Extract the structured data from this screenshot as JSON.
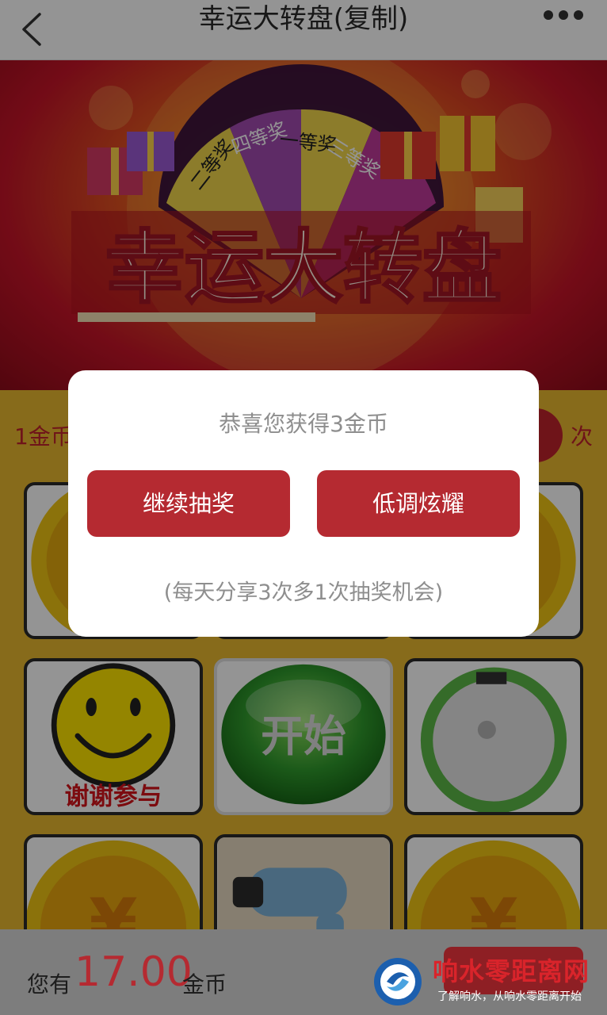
{
  "header": {
    "title": "幸运大转盘(复制)"
  },
  "banner": {
    "wheel_segments": [
      "二等奖",
      "四等奖",
      "一等奖",
      "三等奖"
    ],
    "title": "幸运大转盘"
  },
  "stats": {
    "price_text": "1金币",
    "count_unit": "次"
  },
  "grid": {
    "thanks_label": "谢谢参与",
    "start_label": "开始",
    "yen_symbol": "¥"
  },
  "dialog": {
    "message": "恭喜您获得3金币",
    "continue_label": "继续抽奖",
    "flaunt_label": "低调炫耀",
    "note": "(每天分享3次多1次抽奖机会)"
  },
  "bottom": {
    "coins_prefix": "您有",
    "coins_value": "17.00",
    "coins_unit": "金币"
  },
  "watermark": {
    "title": "响水零距离网",
    "subtitle": "了解响水，从响水零距离开始"
  },
  "colors": {
    "accent_red": "#b52a31",
    "background_gold": "#e9b930",
    "green_button": "#2f9a2c"
  }
}
